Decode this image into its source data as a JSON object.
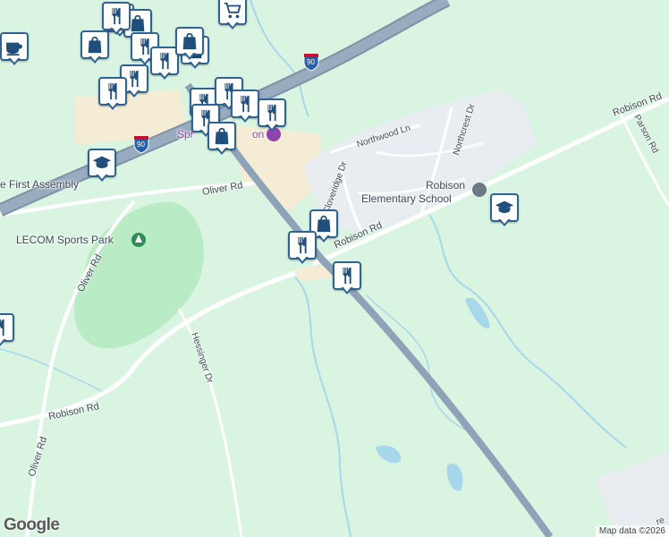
{
  "map": {
    "road_labels": {
      "oliver_rd_top": "Oliver Rd",
      "oliver_rd_left": "Oliver Rd",
      "oliver_rd_bottom": "Oliver Rd",
      "robison_rd_center": "Robison Rd",
      "robison_rd_right": "Robison Rd",
      "robison_rd_bottom": "Robison Rd",
      "hessinger_dr": "Hessinger Dr",
      "parson_rd": "Parson Rd",
      "northwood_ln": "Northwood Ln",
      "northcrest_dr": "Northcrest Dr",
      "cloveridge_dr": "Cloveridge Dr",
      "partial_bottom_right": "re"
    },
    "poi_labels": {
      "first_assembly": "e First Assembly",
      "lecom_sports_park": "LECOM Sports Park",
      "robison_school_line1": "Robison",
      "robison_school_line2": "Elementary School",
      "plaza_partial": "Spr",
      "plaza_partial2": "on"
    },
    "interstate": {
      "number": "90"
    },
    "colors": {
      "land": "#d9f5e2",
      "park": "#b9ebc4",
      "highway": "#8fa3b8",
      "road": "#ffffff",
      "commercial": "#f4ecd5",
      "residential": "#e9edf1",
      "water": "#a7d7ea",
      "pin_border": "#2f6391"
    }
  },
  "markers": [
    {
      "name": "restaurant-marker",
      "icon": "fork-knife-icon"
    },
    {
      "name": "shopping-bag-marker",
      "icon": "shopping-bag-icon"
    },
    {
      "name": "cart-marker",
      "icon": "shopping-cart-icon"
    },
    {
      "name": "cafe-marker",
      "icon": "coffee-cup-icon"
    },
    {
      "name": "school-marker",
      "icon": "graduation-cap-icon"
    }
  ],
  "footer": {
    "logo": "Google",
    "attribution": "Map data ©2026"
  }
}
